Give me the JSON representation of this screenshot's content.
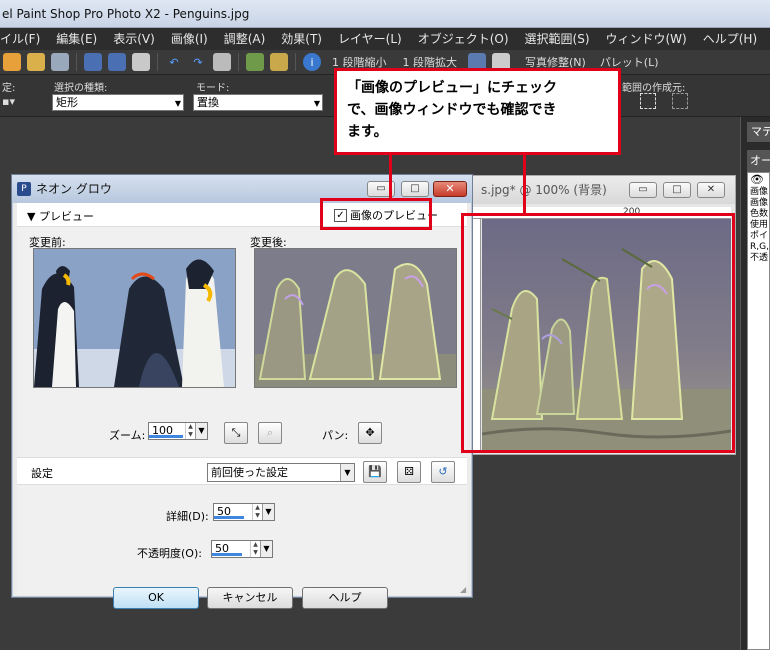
{
  "app": {
    "title": "el Paint Shop Pro Photo X2 - Penguins.jpg"
  },
  "menu": [
    "イル(F)",
    "編集(E)",
    "表示(V)",
    "画像(I)",
    "調整(A)",
    "効果(T)",
    "レイヤー(L)",
    "オブジェクト(O)",
    "選択範囲(S)",
    "ウィンドウ(W)",
    "ヘルプ(H)"
  ],
  "toolbar": {
    "zoom_out": "1 段階縮小",
    "zoom_in": "1 段階拡大",
    "photo_fix": "写真修整(N)",
    "palette": "パレット(L)"
  },
  "options": {
    "preset_label": "定:",
    "selection_type_label": "選択の種類:",
    "selection_type_value": "矩形",
    "mode_label": "モード:",
    "mode_value": "置換",
    "range_label": "範囲の作成元:"
  },
  "image_window": {
    "title": "s.jpg* @ 100% (背景)",
    "ruler_label": "200"
  },
  "palette": {
    "header": "マテ",
    "sub": "オー",
    "lines": [
      "画像",
      "画像",
      "色数",
      "使用",
      "ポイン",
      "R,G,B",
      "不透"
    ]
  },
  "dialog": {
    "title": "ネオン グロウ",
    "preview_toggle": "プレビュー",
    "image_preview_label": "画像のプレビュー",
    "image_preview_checked": true,
    "before_label": "変更前:",
    "after_label": "変更後:",
    "zoom_label": "ズーム:",
    "zoom_value": "100",
    "pan_label": "パン:",
    "settings_label": "設定",
    "settings_value": "前回使った設定",
    "detail_label": "詳細(D):",
    "detail_value": "50",
    "opacity_label": "不透明度(O):",
    "opacity_value": "50",
    "ok_label": "OK",
    "cancel_label": "キャンセル",
    "help_label": "ヘルプ"
  },
  "callout": {
    "text_line1": "「画像のプレビュー」にチェック",
    "text_line2": "で、画像ウィンドウでも確認でき",
    "text_line3": "ます。"
  },
  "colors": {
    "accent_red": "#e0001a",
    "spin_bar": "#3f86e0"
  }
}
